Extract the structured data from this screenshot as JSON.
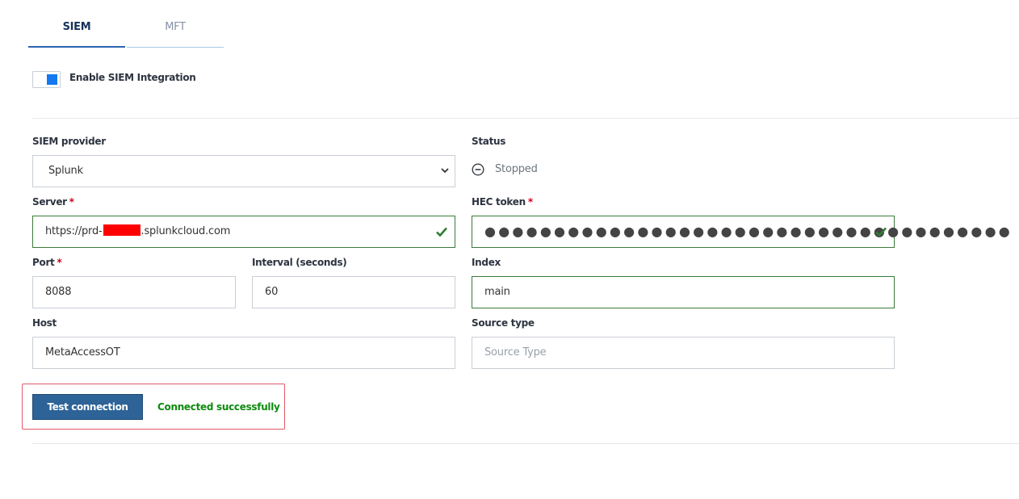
{
  "tabs": [
    {
      "label": "SIEM",
      "active": true
    },
    {
      "label": "MFT",
      "active": false
    }
  ],
  "integration": {
    "toggle_label": "Enable SIEM Integration",
    "enabled": true
  },
  "form": {
    "provider": {
      "label": "SIEM provider",
      "value": "Splunk",
      "icon": "chevron-down-icon"
    },
    "status": {
      "label": "Status",
      "value": "Stopped",
      "icon": "minus-circle-icon"
    },
    "server": {
      "label": "Server",
      "required_mark": "*",
      "value_prefix": "https://prd-",
      "value_suffix": ".splunkcloud.com",
      "valid": true,
      "icon": "check-icon"
    },
    "hec_token": {
      "label": "HEC token",
      "required_mark": "*",
      "masked_value": "●●●●●●●●●●●●●●●●●●●●●●●●●●●●●●●●●●●●●●",
      "valid": true,
      "icon": "check-icon"
    },
    "port": {
      "label": "Port",
      "required_mark": "*",
      "value": "8088"
    },
    "interval": {
      "label": "Interval (seconds)",
      "value": "60"
    },
    "index": {
      "label": "Index",
      "value": "main"
    },
    "host": {
      "label": "Host",
      "value": "MetaAccessOT"
    },
    "source_type": {
      "label": "Source type",
      "value": "",
      "placeholder": "Source Type"
    }
  },
  "actions": {
    "test_button_label": "Test connection",
    "result_message": "Connected successfully"
  },
  "colors": {
    "accent": "#2c64b0",
    "button": "#2d6397",
    "success": "#0e8a0e",
    "valid_border": "#3a7b3a",
    "required": "#d0021b",
    "highlight_box": "#e05a6a"
  }
}
